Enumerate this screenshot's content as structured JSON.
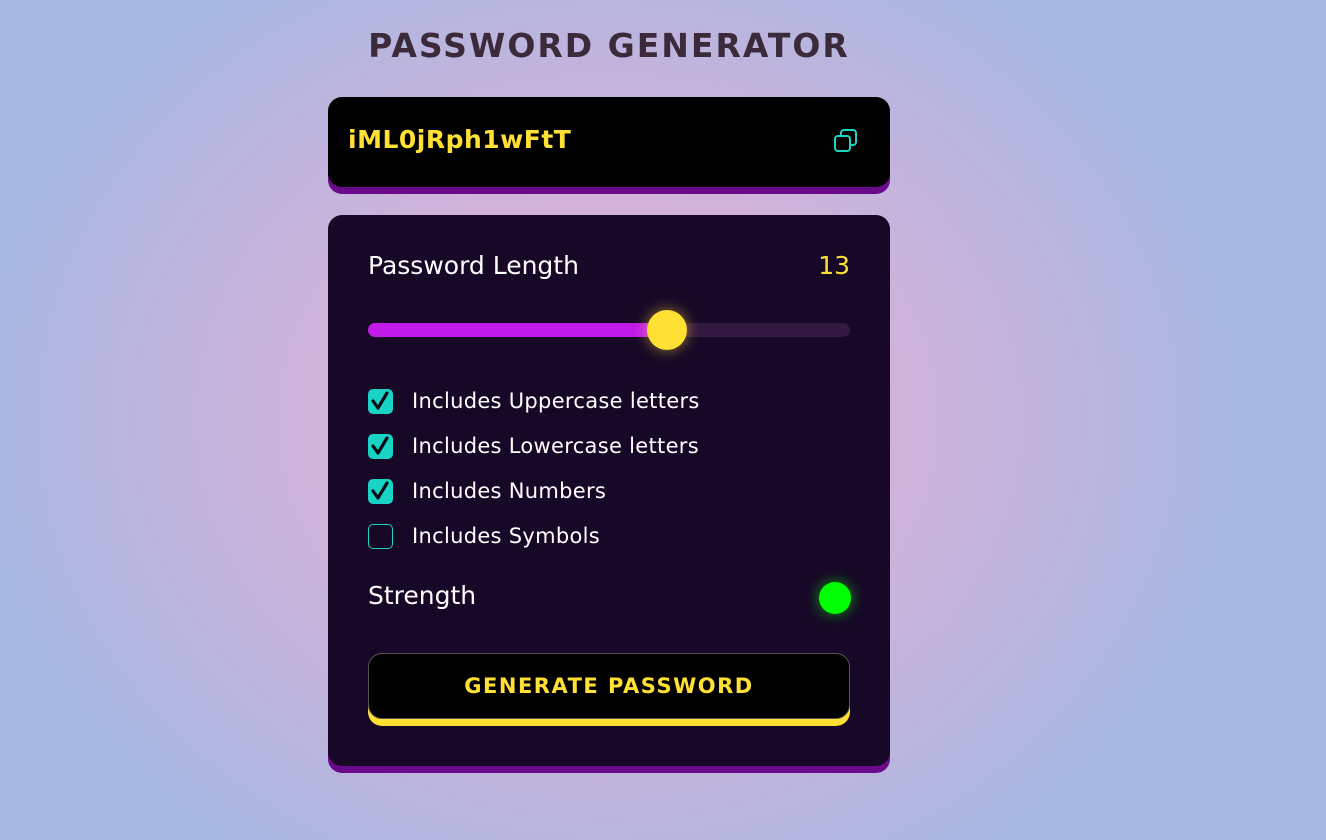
{
  "app": {
    "title": "PASSWORD GENERATOR"
  },
  "password": {
    "value": "iML0jRph1wFtT",
    "copy_icon": "copy-icon"
  },
  "length": {
    "label": "Password Length",
    "value": "13",
    "slider_fraction": 0.62
  },
  "options": [
    {
      "label": "Includes Uppercase letters",
      "checked": true
    },
    {
      "label": "Includes Lowercase letters",
      "checked": true
    },
    {
      "label": "Includes Numbers",
      "checked": true
    },
    {
      "label": "Includes Symbols",
      "checked": false
    }
  ],
  "strength": {
    "label": "Strength",
    "indicator_color": "#00ff00"
  },
  "generate": {
    "label": "GENERATE PASSWORD"
  },
  "colors": {
    "accent_yellow": "#ffe033",
    "accent_purple": "#c01be8",
    "accent_teal": "#19d3c5",
    "panel_bg": "#170827"
  }
}
